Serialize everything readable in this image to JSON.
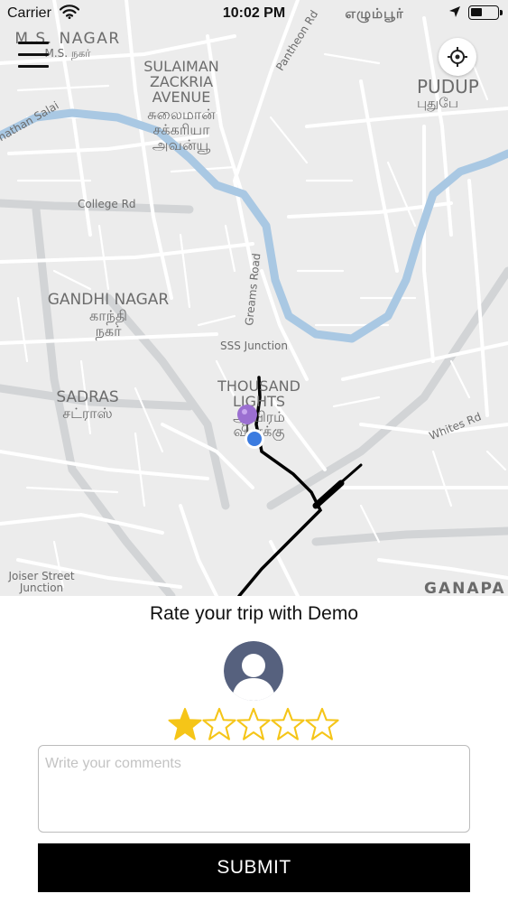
{
  "status_bar": {
    "carrier": "Carrier",
    "time": "10:02 PM"
  },
  "map": {
    "areas": {
      "ms_nagar": "M.S. NAGAR",
      "ms_nagar_ta": "M.S. நகர்",
      "sulaiman_1": "SULAIMAN",
      "sulaiman_2": "ZACKRIA",
      "sulaiman_3": "AVENUE",
      "sulaiman_ta_1": "சுலைமான்",
      "sulaiman_ta_2": "சக்கரியா",
      "sulaiman_ta_3": "அவன்யூ",
      "egmore_ta": "எழும்பூர்",
      "pudup": "PUDUP",
      "pudup_ta": "புதுபே",
      "gandhi_nagar": "GANDHI NAGAR",
      "gandhi_nagar_ta_1": "காந்தி",
      "gandhi_nagar_ta_2": "நகர்",
      "sadras": "SADRAS",
      "sadras_ta": "சட்ராஸ்",
      "thousand_1": "THOUSAND",
      "thousand_2": "LIGHTS",
      "thousand_ta_1": "ஆயிரம்",
      "thousand_ta_2": "விளக்கு",
      "ganapa": "GANAPA"
    },
    "roads": {
      "pantheon": "Pantheon Rd",
      "college": "College Rd",
      "greams": "Greams Road",
      "sss_junction": "SSS Junction",
      "whites": "Whites Rd",
      "nathan_salai": "nathan Salai",
      "joiser_1": "Joiser Street",
      "joiser_2": "Junction"
    },
    "colors": {
      "land": "#ececec",
      "roads": "#ffffff",
      "river": "#a9c8e3",
      "route": "#000000",
      "pin": "#9b6fd1",
      "user_dot": "#3b7be0"
    },
    "icons": {
      "menu": "hamburger-menu-icon",
      "locate": "crosshair-icon",
      "destination": "destination-pin-icon",
      "current_location": "current-location-icon"
    }
  },
  "rating": {
    "title": "Rate your trip with Demo",
    "stars_total": 5,
    "stars_selected": 1,
    "star_color": "#f5c518",
    "comments_placeholder": "Write your comments",
    "submit_label": "SUBMIT"
  }
}
